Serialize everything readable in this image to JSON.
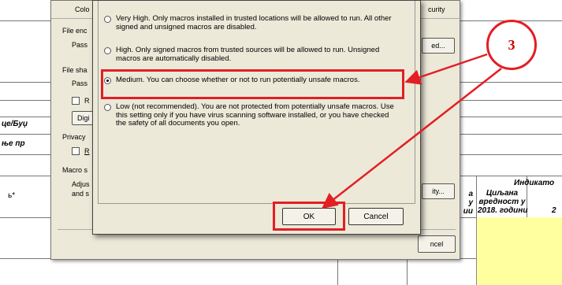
{
  "spreadsheet": {
    "row_label_1": "це/Буџ",
    "row_label_2": "ње пр",
    "row_label_3": "ь*",
    "header_indikat": "Индикато",
    "header_col_a": "а\nу\nии",
    "header_col_b": "Циљана\nвредност у\n2018. години",
    "header_col_c": "\n\n2"
  },
  "options_dialog": {
    "label_color": "Colo",
    "label_file_enc": "File enc",
    "label_pass1": "Pass",
    "label_file_share": "File sha",
    "label_pass2": "Pass",
    "label_r": "R",
    "label_digi": "Digi",
    "label_privacy": "Privacy",
    "label_r2": "R",
    "label_macro": "Macro s",
    "label_adjust": "Adjus",
    "label_and": "and s",
    "tab_security": "curity",
    "button_advanced": "ed...",
    "button_security": "ity...",
    "button_cancel": "ncel"
  },
  "security_dialog": {
    "options": [
      {
        "label": "Very High. Only macros installed in trusted locations will be allowed to run. All other signed and unsigned macros are disabled.",
        "selected": false
      },
      {
        "label": "High. Only signed macros from trusted sources will be allowed to run. Unsigned macros are automatically disabled.",
        "selected": false
      },
      {
        "label": "Medium. You can choose whether or not to run potentially unsafe macros.",
        "selected": true
      },
      {
        "label": "Low (not recommended). You are not protected from potentially unsafe macros. Use this setting only if you have virus scanning software installed, or you have checked the safety of all documents you open.",
        "selected": false
      }
    ],
    "ok_label": "OK",
    "cancel_label": "Cancel"
  },
  "annotation": {
    "step_number": "3",
    "color": "#e31e24"
  }
}
